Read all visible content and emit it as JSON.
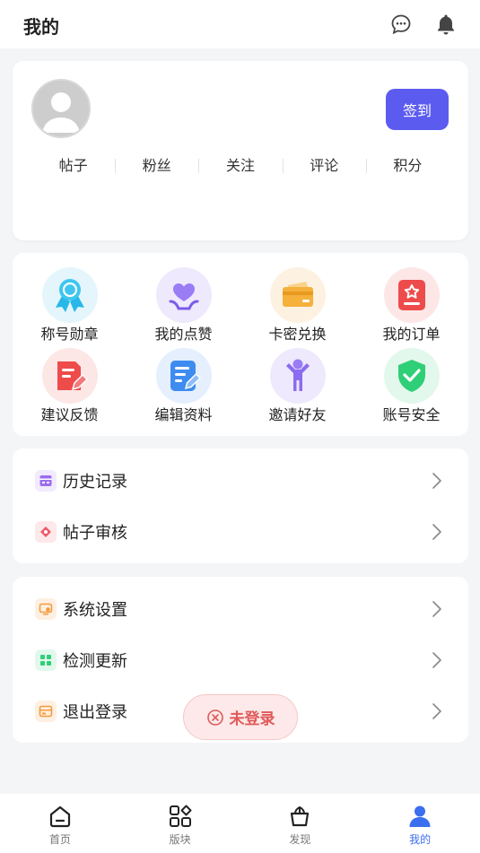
{
  "header": {
    "title": "我的",
    "icons": [
      "chat-icon",
      "bell-icon"
    ]
  },
  "profile": {
    "signin_label": "签到",
    "stats": [
      "帖子",
      "粉丝",
      "关注",
      "评论",
      "积分"
    ]
  },
  "features": [
    {
      "label": "称号勋章",
      "icon": "medal-icon",
      "color": "#28b8e8"
    },
    {
      "label": "我的点赞",
      "icon": "heart-hand-icon",
      "color": "#8b6cf0"
    },
    {
      "label": "卡密兑换",
      "icon": "card-icon",
      "color": "#f5b13c"
    },
    {
      "label": "我的订单",
      "icon": "order-icon",
      "color": "#ee4b4b"
    },
    {
      "label": "建议反馈",
      "icon": "feedback-icon",
      "color": "#ee4b4b"
    },
    {
      "label": "编辑资料",
      "icon": "edit-profile-icon",
      "color": "#3f8cf0"
    },
    {
      "label": "邀请好友",
      "icon": "invite-icon",
      "color": "#8b6cf0"
    },
    {
      "label": "账号安全",
      "icon": "shield-icon",
      "color": "#2fcf78"
    }
  ],
  "list1": [
    {
      "label": "历史记录",
      "icon": "history-icon",
      "color": "#9b6cf0"
    },
    {
      "label": "帖子审核",
      "icon": "review-icon",
      "color": "#ee5a6a"
    }
  ],
  "list2": [
    {
      "label": "系统设置",
      "icon": "settings-icon",
      "color": "#f59a3c"
    },
    {
      "label": "检测更新",
      "icon": "update-icon",
      "color": "#2fcf78"
    },
    {
      "label": "退出登录",
      "icon": "logout-icon",
      "color": "#f59a3c"
    }
  ],
  "toast": {
    "label": "未登录",
    "icon": "close-circle-icon"
  },
  "tabs": [
    {
      "label": "首页",
      "icon": "home-icon"
    },
    {
      "label": "版块",
      "icon": "blocks-icon"
    },
    {
      "label": "发现",
      "icon": "discover-icon"
    },
    {
      "label": "我的",
      "icon": "user-icon",
      "active": true
    }
  ],
  "colors": {
    "accent": "#5b5bf0",
    "active_tab": "#3c6ef0",
    "toast_text": "#e05a5a"
  }
}
